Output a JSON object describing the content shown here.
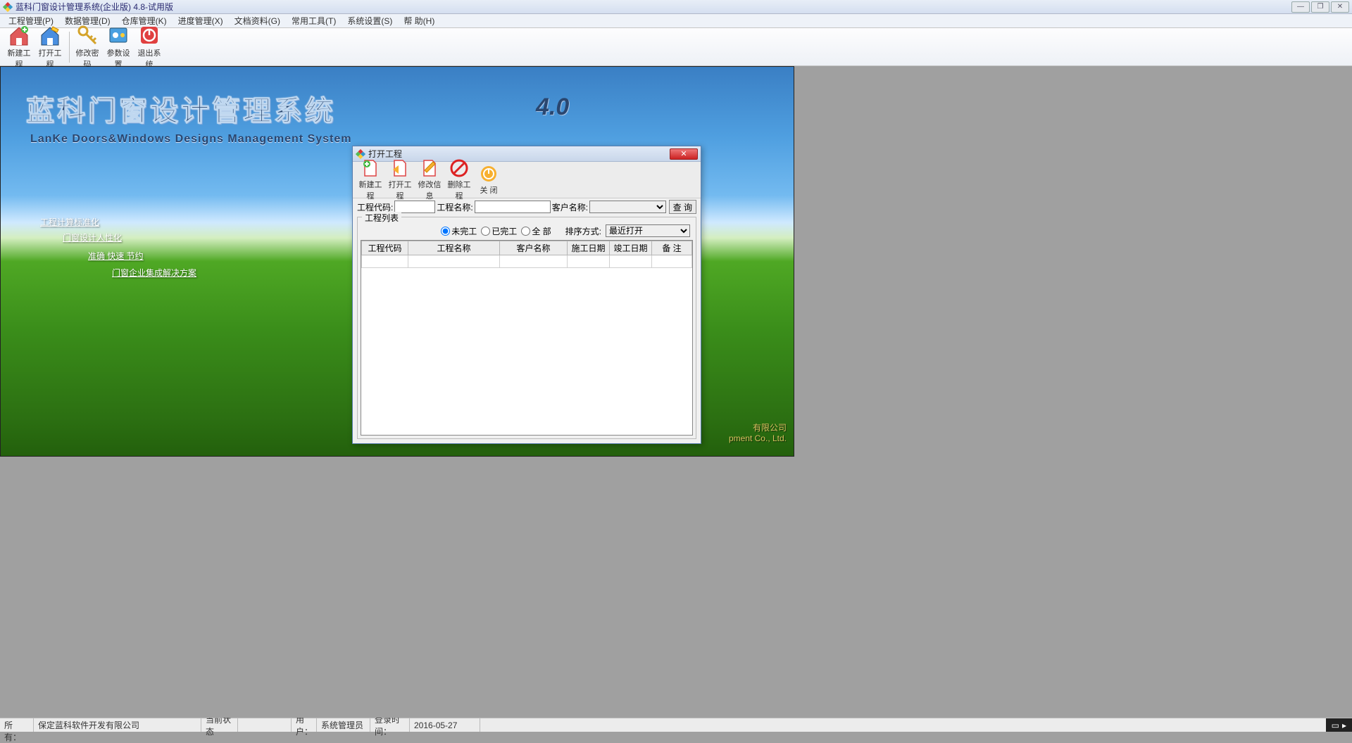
{
  "window": {
    "title": "蓝科门窗设计管理系统(企业版) 4.8-试用版"
  },
  "menubar": [
    "工程管理(P)",
    "数据管理(D)",
    "仓库管理(K)",
    "进度管理(X)",
    "文档资料(G)",
    "常用工具(T)",
    "系统设置(S)",
    "帮 助(H)"
  ],
  "main_toolbar": {
    "new_project": "新建工程",
    "open_project": "打开工程",
    "change_password": "修改密码",
    "param_settings": "参数设置",
    "exit_system": "退出系统"
  },
  "backdrop": {
    "title_cn": "蓝科门窗设计管理系统",
    "version": "4.0",
    "title_en": "LanKe Doors&Windows Designs Management System",
    "lines": [
      "工程计算标准化",
      "门窗设计人性化",
      "准确 快速 节约",
      "门窗企业集成解决方案"
    ],
    "company_cn_suffix": "有限公司",
    "company_en_suffix": "pment Co., Ltd."
  },
  "dialog": {
    "title": "打开工程",
    "toolbar": {
      "new_project": "新建工程",
      "open_project": "打开工程",
      "edit_info": "修改信息",
      "delete_project": "删除工程",
      "close": "关 闭"
    },
    "search": {
      "project_code_label": "工程代码:",
      "project_code_value": "",
      "project_name_label": "工程名称:",
      "project_name_value": "",
      "customer_label": "客户名称:",
      "customer_value": "",
      "query_btn": "查 询"
    },
    "group_label": "工程列表",
    "filter": {
      "unfinished": "未完工",
      "finished": "已完工",
      "all": "全 部",
      "sort_label": "排序方式:",
      "sort_value": "最近打开"
    },
    "columns": [
      "工程代码",
      "工程名称",
      "客户名称",
      "施工日期",
      "竣工日期",
      "备 注"
    ],
    "rows": [
      [
        "",
        "",
        "",
        "",
        "",
        ""
      ]
    ]
  },
  "statusbar": {
    "copyright_label": "版权所有：",
    "copyright_value": "保定蓝科软件开发有限公司",
    "state_label": "当前状态",
    "state_value": "",
    "user_label": "用户：",
    "user_value": "系统管理员",
    "login_label": "登录时间：",
    "login_value": "2016-05-27"
  }
}
